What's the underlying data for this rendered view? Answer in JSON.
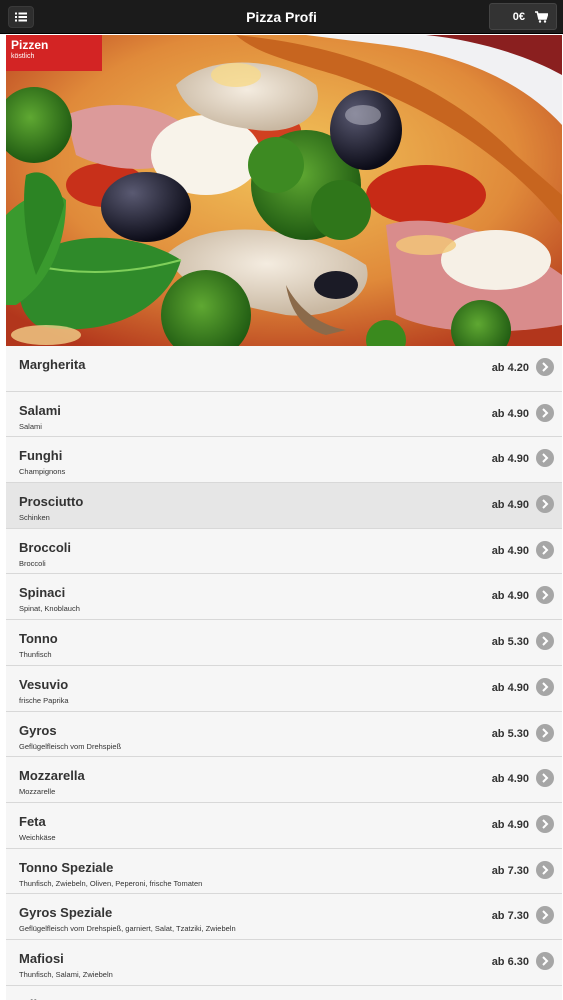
{
  "header": {
    "title": "Pizza Profi",
    "cart_total": "0€"
  },
  "hero": {
    "badge_title": "Pizzen",
    "badge_subtitle": "köstlich"
  },
  "menu_items": [
    {
      "name": "Margherita",
      "desc": "",
      "price": "ab 4.20"
    },
    {
      "name": "Salami",
      "desc": "Salami",
      "price": "ab 4.90"
    },
    {
      "name": "Funghi",
      "desc": "Champignons",
      "price": "ab 4.90"
    },
    {
      "name": "Prosciutto",
      "desc": "Schinken",
      "price": "ab 4.90"
    },
    {
      "name": "Broccoli",
      "desc": "Broccoli",
      "price": "ab 4.90"
    },
    {
      "name": "Spinaci",
      "desc": "Spinat, Knoblauch",
      "price": "ab 4.90"
    },
    {
      "name": "Tonno",
      "desc": "Thunfisch",
      "price": "ab 5.30"
    },
    {
      "name": "Vesuvio",
      "desc": "frische Paprika",
      "price": "ab 4.90"
    },
    {
      "name": "Gyros",
      "desc": "Geflügelfleisch vom Drehspieß",
      "price": "ab 5.30"
    },
    {
      "name": "Mozzarella",
      "desc": "Mozzarelle",
      "price": "ab 4.90"
    },
    {
      "name": "Feta",
      "desc": "Weichkäse",
      "price": "ab 4.90"
    },
    {
      "name": "Tonno Speziale",
      "desc": "Thunfisch, Zwiebeln, Oliven, Peperoni, frische Tomaten",
      "price": "ab 7.30"
    },
    {
      "name": "Gyros Speziale",
      "desc": "Geflügelfleisch vom Drehspieß, garniert, Salat, Tzatziki, Zwiebeln",
      "price": "ab 7.30"
    },
    {
      "name": "Mafiosi",
      "desc": "Thunfisch, Salami, Zwiebeln",
      "price": "ab 6.30"
    },
    {
      "name": "Milano",
      "desc": "",
      "price": ""
    }
  ],
  "selected_index": 3,
  "icons": {
    "menu": "list-icon",
    "cart": "shopping-cart-icon",
    "row_arrow": "chevron-right-icon"
  },
  "colors": {
    "header_bg": "#1b1b1b",
    "badge_bg": "#d32424",
    "row_bg": "#f6f6f6",
    "row_active_bg": "#e6e6e6",
    "chevron_bg": "#a6a6a6"
  }
}
